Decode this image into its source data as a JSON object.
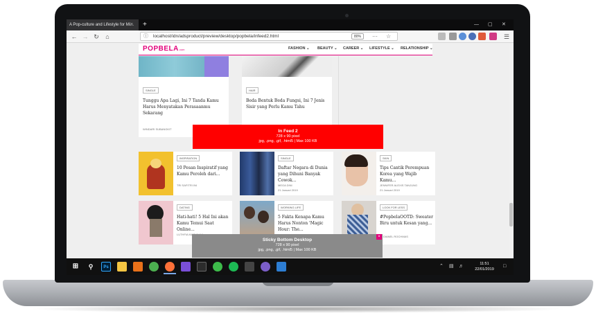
{
  "browser": {
    "tab_title": "A Pop-culture and Lifestyle for Mi...",
    "tab_close": "×",
    "new_tab": "+",
    "url": "localhost/idn/adsproduct/preview/desktop/popbela/infeed2.html",
    "zoom": "80%",
    "url_more": "···",
    "window_controls": {
      "minimize": "—",
      "maximize": "▢",
      "close": "✕"
    }
  },
  "site": {
    "logo": "POPBELA",
    "logo_suffix": ".com",
    "menu": [
      "FASHION ⌄",
      "BEAUTY ⌄",
      "CAREER ⌄",
      "LIFESTYLE ⌄",
      "RELATIONSHIP ⌄"
    ]
  },
  "articles_top": [
    {
      "tag": "SINGLE",
      "title": "Tunggu Apa Lagi, Ini 7 Tanda Kamu Harus Menyatakan Perasaanmu Sekarang",
      "author": "WINDARI SUBANGKIT",
      "date": "21 Januari 2019"
    },
    {
      "tag": "HAIR",
      "title": "Beda Bentuk Beda Fungsi, Ini 7 Jenis Sisir yang Perlu Kamu Tahu",
      "author": "JENNIFER ALEXIS TANJUNG",
      "date": "21 Januari 2019"
    }
  ],
  "ad_infeed": {
    "title": "In Feed 2",
    "size": "728 x 90 pixel",
    "formats": "jpg, .png, .gif, .html5 | Max 100 KB"
  },
  "articles_grid": [
    {
      "tag": "INSPIRATION",
      "title": "10 Pesan Inspiratif yang Kamu Peroleh dari...",
      "author": "TRI SAFITRI INI",
      "date": ""
    },
    {
      "tag": "SINGLE",
      "title": "Daftar Negara di Dunia yang Dihuni Banyak Cowok...",
      "author": "MEGA DINI",
      "date": "21 Januari 2019"
    },
    {
      "tag": "SKIN",
      "title": "Tips Cantik Perempuan Korea yang Wajib Kamu...",
      "author": "JENNIFER ALEXIS TANJUNG",
      "date": "21 Januari 2019"
    },
    {
      "tag": "DATING",
      "title": "Hati-hati! 5 Hal Ini akan Kamu Temui Saat Online...",
      "author": "LUTHFIA MASYIHAJ",
      "date": ""
    },
    {
      "tag": "WORKING LIFE",
      "title": "5 Fakta Kenapa Kamu Harus Nonton 'Magic Hour: The...",
      "author": "",
      "date": ""
    },
    {
      "tag": "LOOK FOR LESS",
      "title": "#PopbelaOOTD: Sweater Biru untuk Kesan yang...",
      "author": "DIANEL ROCHMAS",
      "date": ""
    }
  ],
  "ad_sticky": {
    "title": "Sticky Bottom Desktop",
    "size": "728 x 90 pixel",
    "formats": "jpg, .png, .gif, .html5 | Max 100 KB",
    "close": "×"
  },
  "taskbar": {
    "apps": [
      "Ps",
      "",
      "",
      "",
      "",
      "",
      "",
      "",
      "",
      "",
      ""
    ],
    "clock_time": "11:51",
    "clock_date": "22/01/2019"
  },
  "colors": {
    "brand": "#e2007a",
    "ad_red": "#ff0000",
    "ad_grey": "#8a8a8a"
  }
}
